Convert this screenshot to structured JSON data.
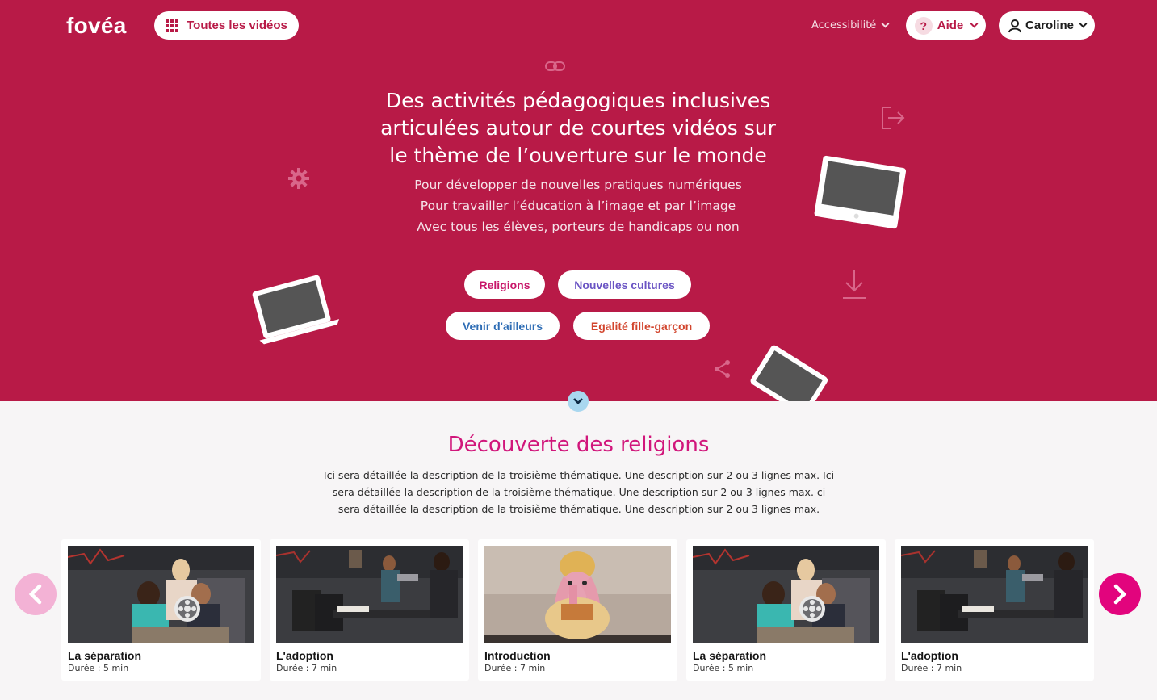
{
  "header": {
    "logo": "fovéa",
    "all_videos_label": "Toutes les vidéos",
    "accessibility_label": "Accessibilité",
    "help_label": "Aide",
    "help_icon_glyph": "?",
    "user_label": "Caroline"
  },
  "hero": {
    "title_line1": "Des activités pédagogiques inclusives",
    "title_line2": "articulées autour de courtes vidéos sur",
    "title_line3": "le thème de l’ouverture sur le monde",
    "sub_line1": "Pour développer de nouvelles pratiques numériques",
    "sub_line2": "Pour travailler l’éducation à l’image et par l’image",
    "sub_line3": "Avec tous les élèves, porteurs de handicaps ou non",
    "tags": [
      {
        "label": "Religions",
        "color": "#c8176a"
      },
      {
        "label": "Nouvelles cultures",
        "color": "#6b55c4"
      },
      {
        "label": "Venir d'ailleurs",
        "color": "#2e6db5"
      },
      {
        "label": "Egalité fille-garçon",
        "color": "#d2452d"
      }
    ]
  },
  "section": {
    "title": "Découverte des religions",
    "desc_line1": "Ici sera détaillée la description de la troisième thématique. Une description sur 2 ou 3 lignes max. Ici",
    "desc_line2": "sera détaillée la description de la troisième thématique. Une description sur 2 ou 3 lignes max. ci",
    "desc_line3": "sera détaillée la description de la troisième thématique. Une description sur 2 ou 3 lignes max."
  },
  "videos": [
    {
      "title": "La séparation",
      "duration": "Durée : 5 min",
      "scene": "classroom-kids"
    },
    {
      "title": "L'adoption",
      "duration": "Durée : 7 min",
      "scene": "office"
    },
    {
      "title": "Introduction",
      "duration": "Durée : 7 min",
      "scene": "ganesh-statue"
    },
    {
      "title": "La séparation",
      "duration": "Durée : 5 min",
      "scene": "classroom-kids"
    },
    {
      "title": "L'adoption",
      "duration": "Durée : 7 min",
      "scene": "office"
    }
  ],
  "colors": {
    "brand": "#b81a47",
    "accent_pink": "#e2047d",
    "section_title": "#d1167b"
  },
  "icons": [
    "grid-icon",
    "chevron-down-icon",
    "question-icon",
    "user-icon",
    "link-icon",
    "logout-icon",
    "gear-icon",
    "laptop-icon",
    "monitor-icon",
    "download-icon",
    "share-icon",
    "tablet-icon",
    "scroll-down-icon",
    "chevron-left-icon",
    "chevron-right-icon",
    "film-reel-icon"
  ]
}
